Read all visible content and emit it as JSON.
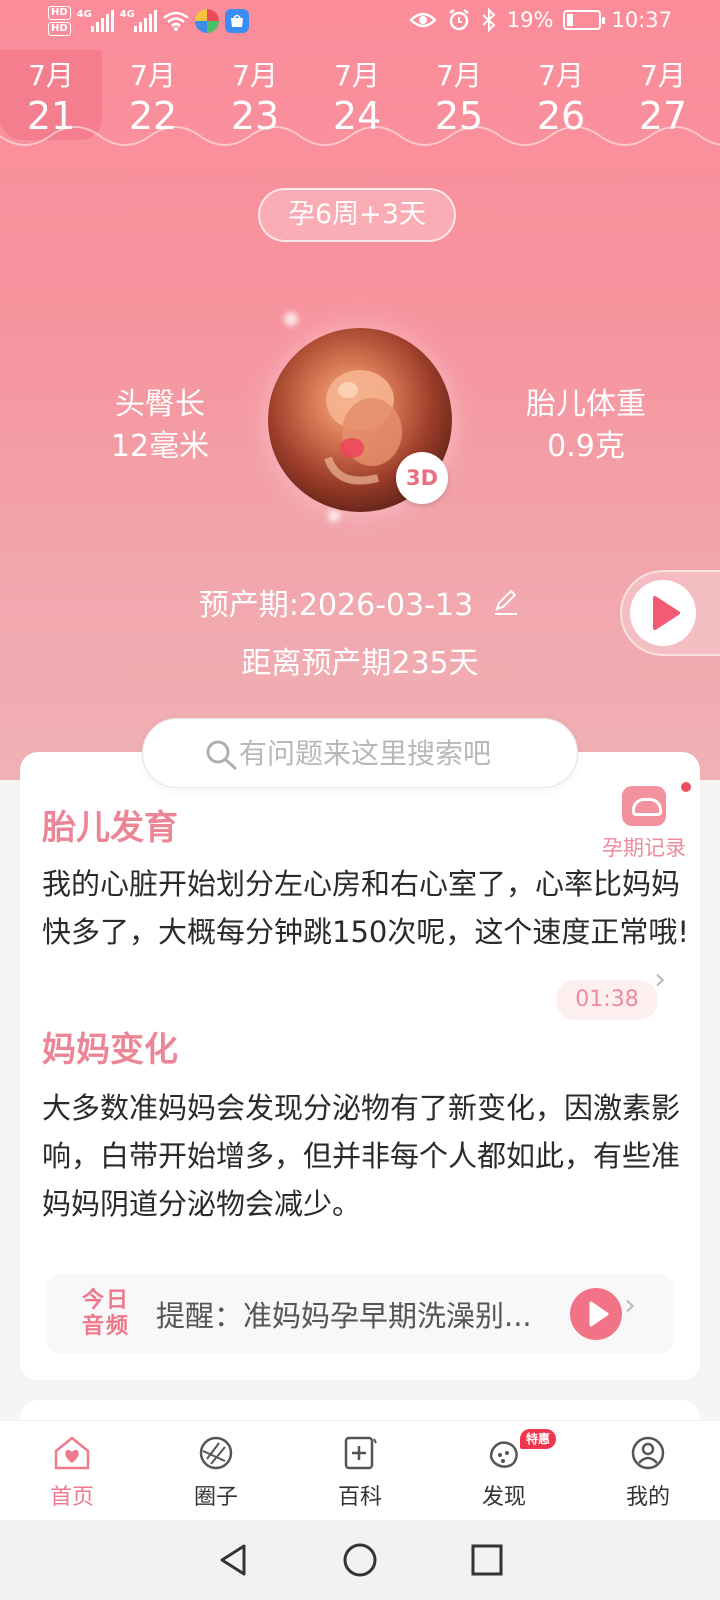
{
  "status_bar": {
    "hd_badges": [
      "HD",
      "HD"
    ],
    "network_labels": [
      "4G",
      "4G"
    ],
    "battery_percent": "19%",
    "time": "10:37",
    "icons": [
      "eye-icon",
      "alarm-icon",
      "bluetooth-icon",
      "battery-icon"
    ]
  },
  "date_strip": {
    "selected_index": 0,
    "days": [
      {
        "month": "7月",
        "day": "21"
      },
      {
        "month": "7月",
        "day": "22"
      },
      {
        "month": "7月",
        "day": "23"
      },
      {
        "month": "7月",
        "day": "24"
      },
      {
        "month": "7月",
        "day": "25"
      },
      {
        "month": "7月",
        "day": "26"
      },
      {
        "month": "7月",
        "day": "27"
      }
    ]
  },
  "pregnancy": {
    "week_label": "孕6周+3天",
    "length_label": "头臀长",
    "length_value": "12毫米",
    "weight_label": "胎儿体重",
    "weight_value": "0.9克",
    "badge_3d": "3D",
    "due_date": "预产期:2026-03-13",
    "countdown": "距离预产期235天"
  },
  "search": {
    "placeholder": "有问题来这里搜索吧"
  },
  "record": {
    "label": "孕期记录"
  },
  "fetal_development": {
    "title": "胎儿发育",
    "text": "我的心脏开始划分左心房和右心室了，心率比妈妈快多了，大概每分钟跳150次呢，这个速度正常哦!",
    "duration": "01:38"
  },
  "mom_changes": {
    "title": "妈妈变化",
    "text": "大多数准妈妈会发现分泌物有了新变化，因激素影响，白带开始增多，但并非每个人都如此，有些准妈妈阴道分泌物会减少。"
  },
  "daily_audio": {
    "logo_line1": "今日",
    "logo_line2": "音频",
    "text": "提醒：准妈妈孕早期洗澡别..."
  },
  "tab_bar": {
    "tabs": [
      {
        "label": "首页",
        "icon": "home-heart-icon",
        "active": true
      },
      {
        "label": "圈子",
        "icon": "circle-icon",
        "active": false
      },
      {
        "label": "百科",
        "icon": "encyclopedia-icon",
        "active": false
      },
      {
        "label": "发现",
        "icon": "discover-icon",
        "active": false,
        "badge": "特惠"
      },
      {
        "label": "我的",
        "icon": "profile-icon",
        "active": false
      }
    ]
  },
  "colors": {
    "accent": "#f07a8c",
    "hero_top": "#fb8c9a",
    "hero_bottom": "#f0b1b4"
  }
}
